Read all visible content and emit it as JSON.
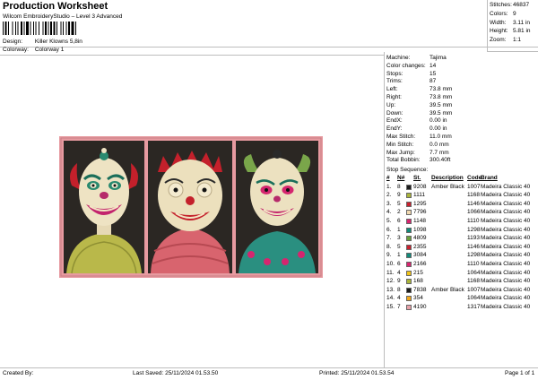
{
  "header": {
    "title": "Production Worksheet",
    "subtitle": "Wilcom EmbroideryStudio – Level 3 Advanced",
    "design_label": "Design:",
    "design_value": "Killer Klowns 5,8in",
    "colorway_label": "Colorway:",
    "colorway_value": "Colorway 1"
  },
  "summary": [
    {
      "label": "Stitches:",
      "value": "46837"
    },
    {
      "label": "Colors:",
      "value": "9"
    },
    {
      "label": "Width:",
      "value": "3.11 in"
    },
    {
      "label": "Height:",
      "value": "5.81 in"
    },
    {
      "label": "Zoom:",
      "value": "1:1"
    }
  ],
  "machine_info": [
    {
      "label": "Machine:",
      "value": "Tajima"
    },
    {
      "label": "Color changes:",
      "value": "14"
    },
    {
      "label": "Stops:",
      "value": "15"
    },
    {
      "label": "Trims:",
      "value": "87"
    },
    {
      "label": "Left:",
      "value": "73.8 mm"
    },
    {
      "label": "Right:",
      "value": "73.8 mm"
    },
    {
      "label": "Up:",
      "value": "39.5 mm"
    },
    {
      "label": "Down:",
      "value": "39.5 mm"
    },
    {
      "label": "EndX:",
      "value": "0.00 in"
    },
    {
      "label": "EndY:",
      "value": "0.00 in"
    },
    {
      "label": "Max Stitch:",
      "value": "11.0 mm"
    },
    {
      "label": "Min Stitch:",
      "value": "0.0 mm"
    },
    {
      "label": "Max Jump:",
      "value": "7.7 mm"
    },
    {
      "label": "Total Bobbin:",
      "value": "300.40ft"
    }
  ],
  "stop_sequence": {
    "title": "Stop Sequence:",
    "headers": [
      "#",
      "N#",
      "St.",
      "Description",
      "Code",
      "Brand"
    ],
    "rows": [
      {
        "stop": "1.",
        "n": "8",
        "color": "#1c1c1c",
        "st": "9208",
        "desc": "Amber Black",
        "code": "1007",
        "brand": "Madeira Classic 40"
      },
      {
        "stop": "2.",
        "n": "9",
        "color": "#a9b43a",
        "st": "1111",
        "desc": "",
        "code": "1168",
        "brand": "Madeira Classic 40"
      },
      {
        "stop": "3.",
        "n": "5",
        "color": "#c8222f",
        "st": "1295",
        "desc": "",
        "code": "1146",
        "brand": "Madeira Classic 40"
      },
      {
        "stop": "4.",
        "n": "2",
        "color": "#f2d9b0",
        "st": "7796",
        "desc": "",
        "code": "1066",
        "brand": "Madeira Classic 40"
      },
      {
        "stop": "5.",
        "n": "6",
        "color": "#d6266f",
        "st": "1148",
        "desc": "",
        "code": "1110",
        "brand": "Madeira Classic 40"
      },
      {
        "stop": "6.",
        "n": "1",
        "color": "#138a7a",
        "st": "1098",
        "desc": "",
        "code": "1298",
        "brand": "Madeira Classic 40"
      },
      {
        "stop": "7.",
        "n": "3",
        "color": "#6ba03c",
        "st": "4809",
        "desc": "",
        "code": "1193",
        "brand": "Madeira Classic 40"
      },
      {
        "stop": "8.",
        "n": "5",
        "color": "#c8222f",
        "st": "2355",
        "desc": "",
        "code": "1146",
        "brand": "Madeira Classic 40"
      },
      {
        "stop": "9.",
        "n": "1",
        "color": "#138a7a",
        "st": "3084",
        "desc": "",
        "code": "1298",
        "brand": "Madeira Classic 40"
      },
      {
        "stop": "10.",
        "n": "6",
        "color": "#d6266f",
        "st": "2166",
        "desc": "",
        "code": "1110",
        "brand": "Madeira Classic 40"
      },
      {
        "stop": "11.",
        "n": "4",
        "color": "#f0c419",
        "st": "215",
        "desc": "",
        "code": "1064",
        "brand": "Madeira Classic 40"
      },
      {
        "stop": "12.",
        "n": "9",
        "color": "#a9b43a",
        "st": "168",
        "desc": "",
        "code": "1168",
        "brand": "Madeira Classic 40"
      },
      {
        "stop": "13.",
        "n": "8",
        "color": "#1c1c1c",
        "st": "7838",
        "desc": "Amber Black",
        "code": "1007",
        "brand": "Madeira Classic 40"
      },
      {
        "stop": "14.",
        "n": "4",
        "color": "#f0a81c",
        "st": "354",
        "desc": "",
        "code": "1064",
        "brand": "Madeira Classic 40"
      },
      {
        "stop": "15.",
        "n": "7",
        "color": "#e7a1a8",
        "st": "4190",
        "desc": "",
        "code": "1317",
        "brand": "Madeira Classic 40"
      }
    ]
  },
  "footer": {
    "created_by": "Created By:",
    "last_saved": "Last Saved: 25/11/2024 01.53.50",
    "printed": "Printed: 25/11/2024 01.53.54",
    "page": "Page 1 of 1"
  }
}
